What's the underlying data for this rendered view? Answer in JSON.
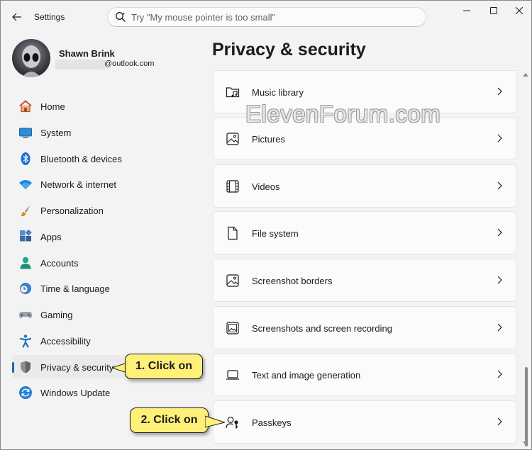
{
  "window": {
    "title": "Settings",
    "search_placeholder": "Try \"My mouse pointer is too small\""
  },
  "profile": {
    "name": "Shawn Brink",
    "email_suffix": "@outlook.com"
  },
  "sidebar": {
    "items": [
      {
        "label": "Home",
        "icon": "home-icon"
      },
      {
        "label": "System",
        "icon": "system-icon"
      },
      {
        "label": "Bluetooth & devices",
        "icon": "bluetooth-icon"
      },
      {
        "label": "Network & internet",
        "icon": "wifi-icon"
      },
      {
        "label": "Personalization",
        "icon": "brush-icon"
      },
      {
        "label": "Apps",
        "icon": "apps-icon"
      },
      {
        "label": "Accounts",
        "icon": "accounts-icon"
      },
      {
        "label": "Time & language",
        "icon": "clock-globe-icon"
      },
      {
        "label": "Gaming",
        "icon": "gamepad-icon"
      },
      {
        "label": "Accessibility",
        "icon": "accessibility-icon"
      },
      {
        "label": "Privacy & security",
        "icon": "shield-icon",
        "selected": true
      },
      {
        "label": "Windows Update",
        "icon": "update-icon"
      }
    ]
  },
  "main": {
    "title": "Privacy & security",
    "watermark": "ElevenForum.com",
    "settings": [
      {
        "label": "Music library",
        "icon": "music-folder-icon"
      },
      {
        "label": "Pictures",
        "icon": "picture-icon"
      },
      {
        "label": "Videos",
        "icon": "video-icon"
      },
      {
        "label": "File system",
        "icon": "document-icon"
      },
      {
        "label": "Screenshot borders",
        "icon": "screenshot-border-icon"
      },
      {
        "label": "Screenshots and screen recording",
        "icon": "screenshot-icon"
      },
      {
        "label": "Text and image generation",
        "icon": "laptop-icon"
      },
      {
        "label": "Passkeys",
        "icon": "passkey-icon"
      }
    ]
  },
  "callouts": {
    "first": "1. Click on",
    "second": "2. Click on"
  },
  "colors": {
    "accent": "#0067c0",
    "callout_fill": "#fff07a"
  }
}
